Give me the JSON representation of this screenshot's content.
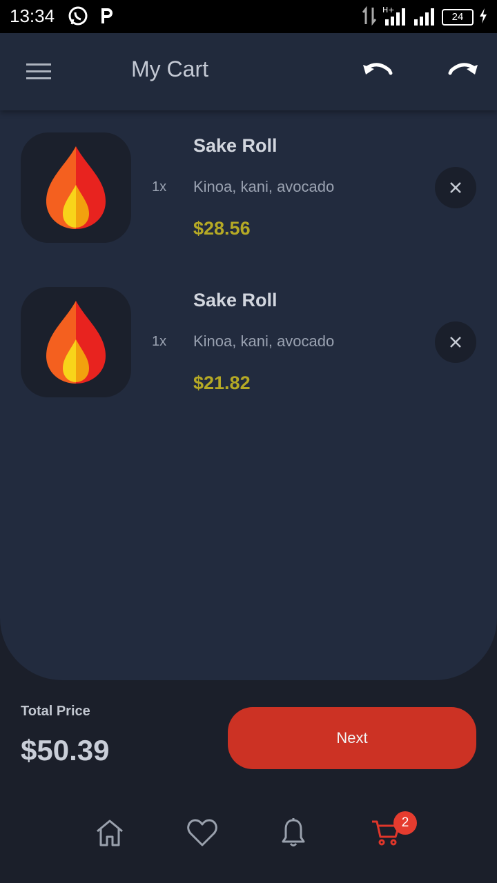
{
  "status_bar": {
    "time": "13:34",
    "battery": "24"
  },
  "header": {
    "title": "My Cart"
  },
  "cart": {
    "items": [
      {
        "name": "Sake Roll",
        "quantity": "1x",
        "description": "Kinoa, kani, avocado",
        "price": "$28.56"
      },
      {
        "name": "Sake Roll",
        "quantity": "1x",
        "description": "Kinoa, kani, avocado",
        "price": "$21.82"
      }
    ]
  },
  "summary": {
    "total_label": "Total Price",
    "total_value": "$50.39",
    "next_label": "Next"
  },
  "nav": {
    "cart_badge": "2"
  },
  "colors": {
    "accent": "#cc3224",
    "price": "#b5a925",
    "panel": "#222b3e",
    "background": "#1b1f2a"
  }
}
